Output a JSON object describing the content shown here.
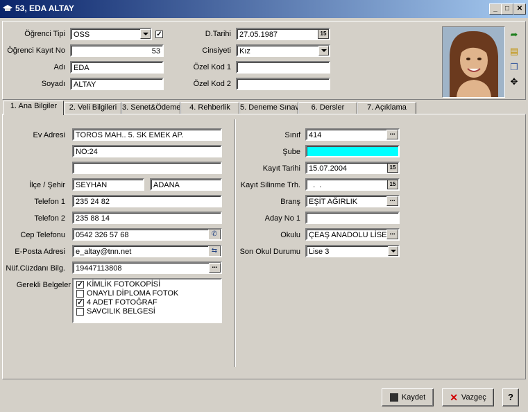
{
  "window": {
    "title": "53, EDA ALTAY",
    "minimize": "_",
    "maximize": "□",
    "close": "✕"
  },
  "header": {
    "ogrenci_tipi": {
      "label": "Öğrenci Tipi",
      "value": "OSS",
      "checked": true
    },
    "kayit_no": {
      "label": "Öğrenci Kayıt No",
      "value": "53"
    },
    "adi": {
      "label": "Adı",
      "value": "EDA"
    },
    "soyadi": {
      "label": "Soyadı",
      "value": "ALTAY"
    },
    "dtarihi": {
      "label": "D.Tarihi",
      "value": "27.05.1987"
    },
    "cinsiyeti": {
      "label": "Cinsiyeti",
      "value": "Kız"
    },
    "ozel_kod1": {
      "label": "Özel Kod 1",
      "value": ""
    },
    "ozel_kod2": {
      "label": "Özel Kod 2",
      "value": ""
    }
  },
  "tabs": [
    {
      "label": "1. Ana Bilgiler",
      "active": true
    },
    {
      "label": "2. Veli Bilgileri"
    },
    {
      "label": "3. Senet&Ödeme"
    },
    {
      "label": "4. Rehberlik"
    },
    {
      "label": "5. Deneme Sınav"
    },
    {
      "label": "6. Dersler"
    },
    {
      "label": "7. Açıklama"
    }
  ],
  "left": {
    "ev_adresi": {
      "label": "Ev Adresi",
      "line1": "TOROS MAH.. 5. SK EMEK AP.",
      "line2": "NO:24",
      "line3": ""
    },
    "ilce_sehir": {
      "label": "İlçe / Şehir",
      "ilce": "SEYHAN",
      "sehir": "ADANA"
    },
    "telefon1": {
      "label": "Telefon 1",
      "value": "235 24 82"
    },
    "telefon2": {
      "label": "Telefon 2",
      "value": "235 88 14"
    },
    "cep": {
      "label": "Cep Telefonu",
      "value": "0542 326 57 68"
    },
    "eposta": {
      "label": "E-Posta Adresi",
      "value": "e_altay@tnn.net"
    },
    "nufus": {
      "label": "Nüf.Cüzdanı Bilg.",
      "value": "19447113808"
    },
    "belgeler": {
      "label": "Gerekli Belgeler",
      "items": [
        {
          "label": "KİMLİK FOTOKOPİSİ",
          "checked": true
        },
        {
          "label": "ONAYLI DİPLOMA FOTOK",
          "checked": false
        },
        {
          "label": "4 ADET FOTOĞRAF",
          "checked": true
        },
        {
          "label": "SAVCILIK BELGESİ",
          "checked": false
        }
      ]
    }
  },
  "right": {
    "sinif": {
      "label": "Sınıf",
      "value": "414"
    },
    "sube": {
      "label": "Şube",
      "value": "",
      "color": "#00ffff"
    },
    "kayit_tarihi": {
      "label": "Kayıt Tarihi",
      "value": "15.07.2004"
    },
    "kayit_silinme": {
      "label": "Kayıt Silinme Trh.",
      "value": "  .  ."
    },
    "brans": {
      "label": "Branş",
      "value": "EŞİT AĞIRLIK"
    },
    "aday_no": {
      "label": "Aday No 1",
      "value": ""
    },
    "okulu": {
      "label": "Okulu",
      "value": "ÇEAŞ ANADOLU LİSESİ"
    },
    "son_okul": {
      "label": "Son Okul Durumu",
      "value": "Lise 3"
    }
  },
  "buttons": {
    "kaydet": "Kaydet",
    "vazgec": "Vazgeç"
  },
  "icons": {
    "calendar": "15",
    "ellipsis": "..."
  }
}
